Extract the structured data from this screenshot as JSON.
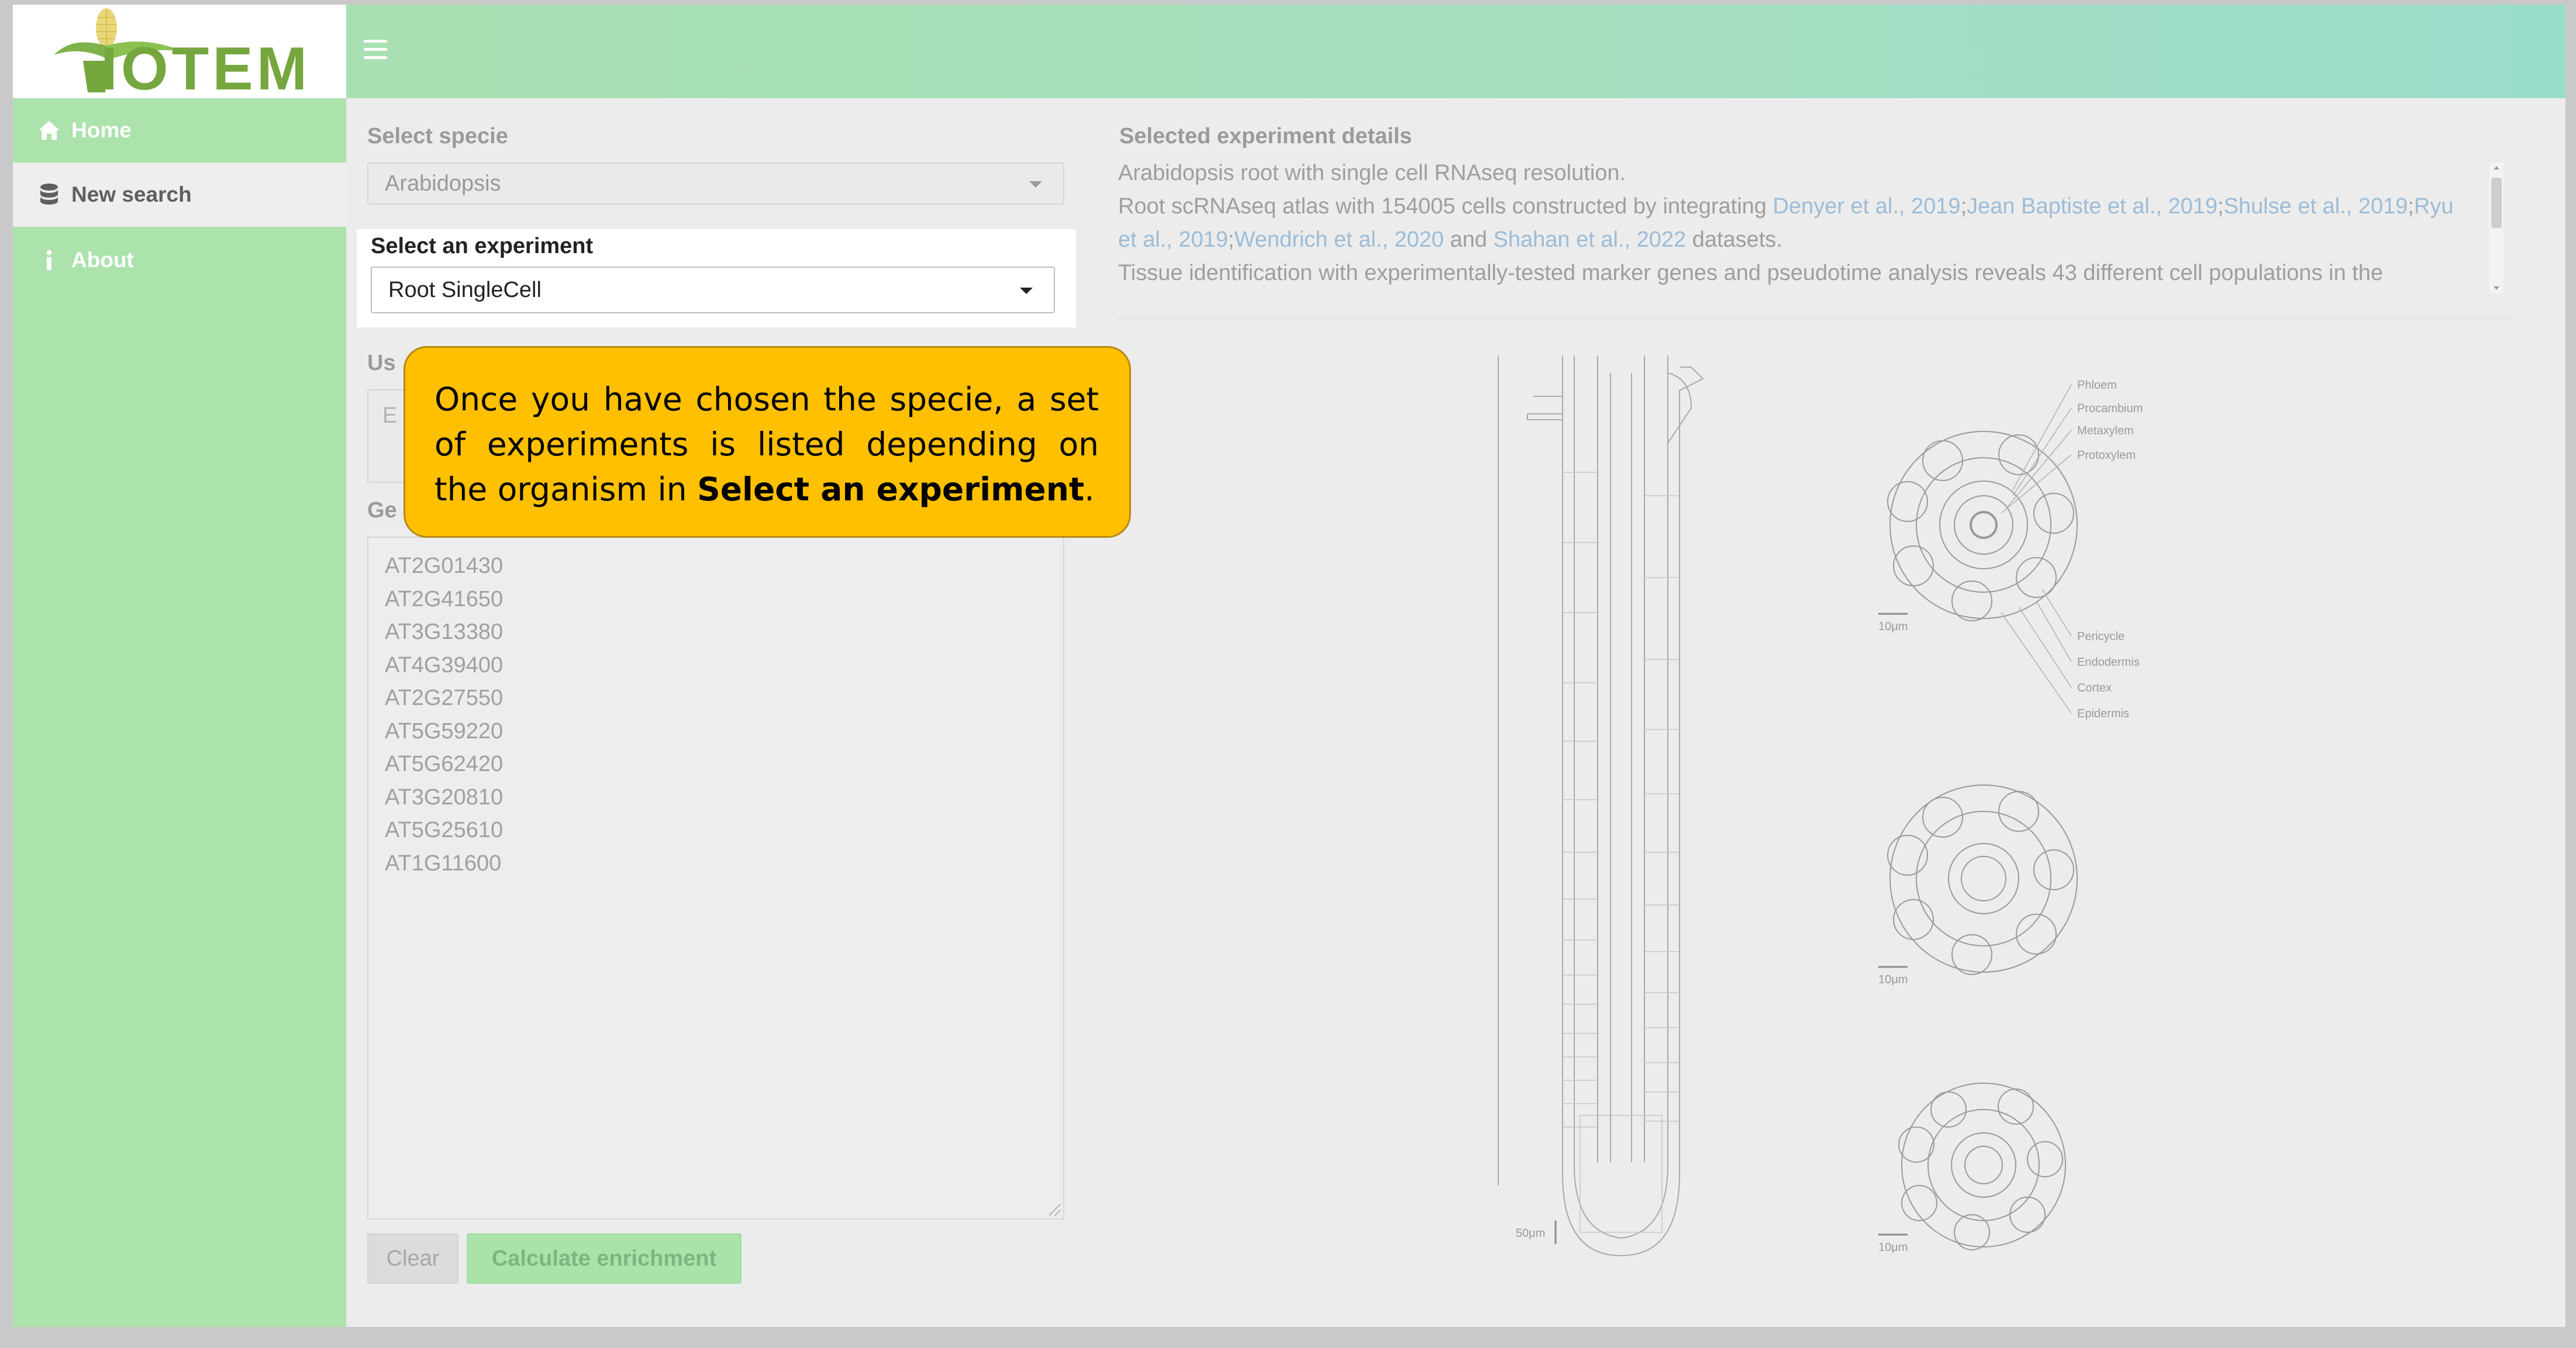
{
  "logo": {
    "text": "IOTEM"
  },
  "sidebar": {
    "items": [
      {
        "label": "Home",
        "icon": "home-icon"
      },
      {
        "label": "New search",
        "icon": "database-icon"
      },
      {
        "label": "About",
        "icon": "info-icon"
      }
    ]
  },
  "form": {
    "specie_label": "Select specie",
    "specie_value": "Arabidopsis",
    "experiment_label": "Select an experiment",
    "experiment_value": "Root SingleCell",
    "user_label_partial": "Us",
    "user_input_partial": "E",
    "genes_label_partial": "Ge",
    "genes": [
      "AT2G01430",
      "AT2G41650",
      "AT3G13380",
      "AT4G39400",
      "AT2G27550",
      "AT5G59220",
      "AT5G62420",
      "AT3G20810",
      "AT5G25610",
      "AT1G11600"
    ],
    "clear_label": "Clear",
    "calculate_label": "Calculate enrichment"
  },
  "details": {
    "title": "Selected experiment details",
    "line1": "Arabidopsis root with single cell RNAseq resolution.",
    "line2_prefix": "Root scRNAseq atlas with 154005 cells constructed by integrating ",
    "links": [
      "Denyer et al., 2019",
      "Jean Baptiste et al., 2019",
      "Shulse et al., 2019",
      "Ryu et al., 2019",
      "Wendrich et al., 2020"
    ],
    "sep": ";",
    "and": " and ",
    "link_last": "Shahan et al., 2022",
    "suffix": " datasets.",
    "line3": "Tissue identification with experimentally-tested marker genes and pseudotime analysis reveals 43 different cell populations in the"
  },
  "illustration": {
    "tissue_labels": [
      "Phloem",
      "Procambium",
      "Metaxylem",
      "Protoxylem",
      "Pericycle",
      "Endodermis",
      "Cortex",
      "Epidermis"
    ],
    "scale_root": "50μm",
    "scale_section": "10μm"
  },
  "callout": {
    "text_pre": "Once you have chosen the specie, a set of experiments is listed depending on the organism in ",
    "text_bold": "Select an experiment",
    "text_post": "."
  },
  "colors": {
    "sidebar": "#ace2ac",
    "header_start": "#a9e0b1",
    "header_end": "#9adccb",
    "callout": "#fec000",
    "link": "#9dbcd6"
  }
}
